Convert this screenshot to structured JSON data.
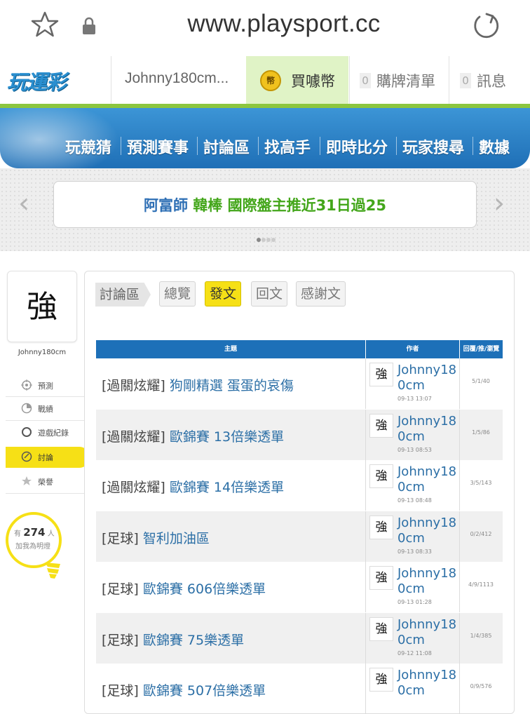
{
  "browser": {
    "url": "www.playsport.cc"
  },
  "header": {
    "logo_text": "玩運彩",
    "username": "Johnny180cm...",
    "coin_icon_text": "幣",
    "coin_label": "買噱幣",
    "cart_count": "0",
    "cart_label": "購牌清單",
    "msg_count": "0",
    "msg_label": "訊息"
  },
  "nav": {
    "items": [
      "玩競猜",
      "預測賽事",
      "討論區",
      "找高手",
      "即時比分",
      "玩家搜尋",
      "數據"
    ]
  },
  "marquee": {
    "who": "阿富師",
    "text": " 韓棒 國際盤主推近31日過25"
  },
  "sidebar": {
    "avatar_char": "強",
    "name": "Johnny180cm",
    "items": [
      {
        "label": "預測",
        "icon": "target-icon"
      },
      {
        "label": "戰績",
        "icon": "chart-icon"
      },
      {
        "label": "遊戲紀錄",
        "icon": "circle-icon"
      },
      {
        "label": "討論",
        "icon": "discussion-icon"
      },
      {
        "label": "榮譽",
        "icon": "medal-icon"
      }
    ],
    "fans_prefix": "有",
    "fans_count": "274",
    "fans_suffix": "人",
    "fans_label": "加我為明燈"
  },
  "forum": {
    "crumb": "討論區",
    "tabs": [
      "總覽",
      "發文",
      "回文",
      "感謝文"
    ],
    "active_tab": "發文",
    "columns": [
      "主題",
      "作者",
      "回覆/推/瀏覽"
    ],
    "rows": [
      {
        "tag": "[過關炫耀]",
        "subject": " 狗剛精選 蛋蛋的哀傷",
        "author": "Johnny180cm",
        "date": "09-13 13:07",
        "stats": "5/1/40"
      },
      {
        "tag": "[過關炫耀]",
        "subject": " 歐錦賽 13倍樂透單",
        "author": "Johnny180cm",
        "date": "09-13 08:53",
        "stats": "1/5/86"
      },
      {
        "tag": "[過關炫耀]",
        "subject": " 歐錦賽 14倍樂透單",
        "author": "Johnny180cm",
        "date": "09-13 08:48",
        "stats": "3/5/143"
      },
      {
        "tag": "[足球]",
        "subject": " 智利加油區",
        "author": "Johnny180cm",
        "date": "09-13 08:33",
        "stats": "0/2/412"
      },
      {
        "tag": "[足球]",
        "subject": " 歐錦賽 606倍樂透單",
        "author": "Johnny180cm",
        "date": "09-13 01:28",
        "stats": "4/9/1113"
      },
      {
        "tag": "[足球]",
        "subject": " 歐錦賽 75樂透單",
        "author": "Johnny180cm",
        "date": "09-12 11:08",
        "stats": "1/4/385"
      },
      {
        "tag": "[足球]",
        "subject": " 歐錦賽 507倍樂透單",
        "author": "Johnny180cm",
        "date": "",
        "stats": "0/9/576"
      }
    ]
  },
  "colors": {
    "brand_blue": "#1d70b8",
    "accent_yellow": "#f6e016",
    "accent_green": "#8cc63f",
    "link_blue": "#2c6fa6"
  }
}
